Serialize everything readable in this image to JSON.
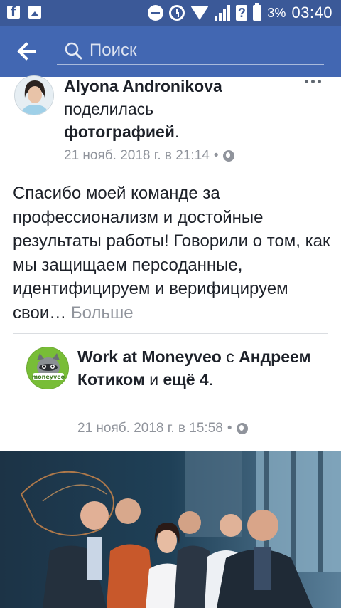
{
  "status_bar": {
    "battery_percent": "3%",
    "time": "03:40",
    "signal_badge": "?"
  },
  "search": {
    "placeholder": "Поиск"
  },
  "post": {
    "author": "Alyona Andronikova",
    "action_prefix": "поделилась",
    "action_object": "фотографией",
    "action_suffix": ".",
    "timestamp": "21 нояб. 2018 г. в 21:14",
    "separator": "•",
    "text": "Спасибо моей команде за профессионализм и достойные результаты работы! Говорили о том, как мы защищаем персоданные, идентифицируем и верифицируем свои…",
    "more_label": "Больше"
  },
  "shared": {
    "logo_text": "moneyveo",
    "page_name": "Work at Moneyveo",
    "with_word": "с",
    "tagged": "Андреем Котиком",
    "and_word": "и",
    "others": "ещё 4",
    "period": ".",
    "timestamp": "21 нояб. 2018 г. в 15:58",
    "separator": "•"
  },
  "colors": {
    "status_bar": "#3b5998",
    "header": "#4267b2",
    "text": "#1d2129",
    "meta": "#90949c"
  }
}
